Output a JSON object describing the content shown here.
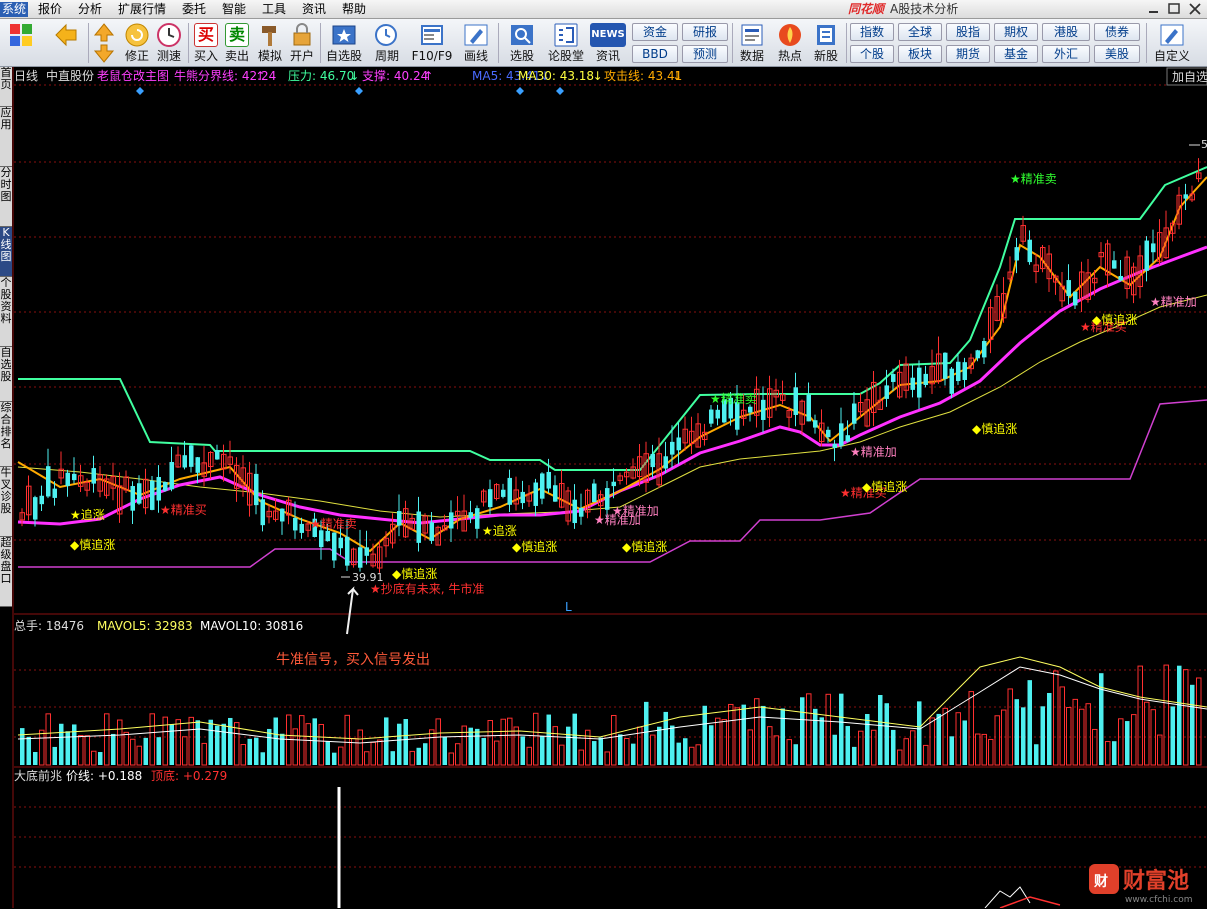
{
  "menu": {
    "items": [
      "系统",
      "报价",
      "分析",
      "扩展行情",
      "委托",
      "智能",
      "工具",
      "资讯",
      "帮助"
    ],
    "brand": "同花顺",
    "subtitle": "A股技术分析"
  },
  "toolbar": {
    "buttons": [
      "修正",
      "测速",
      "买入",
      "卖出",
      "模拟",
      "开户",
      "自选股",
      "周期",
      "F10/F9",
      "画线",
      "选股",
      "论股堂",
      "资讯",
      "数据",
      "热点",
      "新股",
      "自定义"
    ],
    "buy_char": "买",
    "sell_char": "卖",
    "small_boxes": [
      "资金",
      "研报",
      "BBD",
      "预测"
    ],
    "quick_row1": [
      "指数",
      "全球",
      "股指",
      "期权",
      "港股",
      "债券"
    ],
    "quick_row2": [
      "个股",
      "板块",
      "期货",
      "基金",
      "外汇",
      "美股"
    ],
    "news_label": "NEWS",
    "right_button": "加自选"
  },
  "sidebar": {
    "tabs": [
      "首页",
      "应用",
      "分时图",
      "K线图",
      "个股资料",
      "自选股",
      "综合排名",
      "牛叉诊股",
      "超级盘口"
    ]
  },
  "main_chart": {
    "period": "日线",
    "stock": "中直股份",
    "indicator": "老鼠仓改主图",
    "legend": [
      {
        "label": "牛熊分界线: 42.24",
        "color": "#ff40ff",
        "arrow": "↑"
      },
      {
        "label": "压力: 46.70",
        "color": "#40ffa0",
        "arrow": "↓"
      },
      {
        "label": "支撑: 40.24",
        "color": "#ff40ff",
        "arrow": "↑"
      },
      {
        "label": "MA5: 43.41",
        "color": "#4a6bff",
        "arrow": "↓"
      },
      {
        "label": "MA30: 43.18",
        "color": "#ffff40",
        "arrow": "↓"
      },
      {
        "label": "攻击线: 43.41",
        "color": "#ffaa00",
        "arrow": "↓"
      }
    ],
    "low_price_label": "39.91",
    "high_price_label": "5",
    "axis_marker": "L",
    "signals": [
      {
        "text": "追涨",
        "color": "#ffff00",
        "type": "star"
      },
      {
        "text": "慎追涨",
        "color": "#ffff00",
        "type": "diamond"
      },
      {
        "text": "精准买",
        "color": "#ff3030",
        "type": "star"
      },
      {
        "text": "精准卖",
        "color": "#ff3030",
        "type": "star"
      },
      {
        "text": "慎追涨",
        "color": "#ffff00",
        "type": "diamond"
      },
      {
        "text": "抄底有未来, 牛市准",
        "color": "#ff3030",
        "type": "star"
      },
      {
        "text": "追涨",
        "color": "#ffff00",
        "type": "star"
      },
      {
        "text": "慎追涨",
        "color": "#ffff00",
        "type": "diamond"
      },
      {
        "text": "精准加",
        "color": "#ff80c0",
        "type": "star"
      },
      {
        "text": "精准加",
        "color": "#ff80c0",
        "type": "star"
      },
      {
        "text": "慎追涨",
        "color": "#ffff00",
        "type": "diamond"
      },
      {
        "text": "精准卖",
        "color": "#30ff30",
        "type": "star"
      },
      {
        "text": "精准加",
        "color": "#ff80c0",
        "type": "star"
      },
      {
        "text": "精准买",
        "color": "#ff3030",
        "type": "star"
      },
      {
        "text": "慎追涨",
        "color": "#ffff00",
        "type": "diamond"
      },
      {
        "text": "慎追涨",
        "color": "#ffff00",
        "type": "diamond"
      },
      {
        "text": "精准卖",
        "color": "#30ff30",
        "type": "star"
      },
      {
        "text": "精准买",
        "color": "#ff3030",
        "type": "star"
      },
      {
        "text": "慎追涨",
        "color": "#ffff00",
        "type": "diamond"
      },
      {
        "text": "精准加",
        "color": "#ff80c0",
        "type": "star"
      }
    ],
    "annotation": "牛准信号，买入信号发出"
  },
  "volume_panel": {
    "title": "总手: 18476",
    "mavol5": "MAVOL5: 32983",
    "mavol10": "MAVOL10: 30816"
  },
  "bottom_panel": {
    "title": "大底前兆",
    "price_line": "价线: +0.188",
    "top_bottom": "顶底: +0.279"
  },
  "watermark": {
    "brand": "财富池",
    "url": "www.cfchi.com"
  },
  "colors": {
    "up": "#ff3030",
    "down": "#4ef0f0",
    "resistance": "#40ffa0",
    "support": "#d040d0",
    "bull_bear": "#ff30ff",
    "ma30": "#e0e040",
    "attack": "#ffaa00"
  }
}
